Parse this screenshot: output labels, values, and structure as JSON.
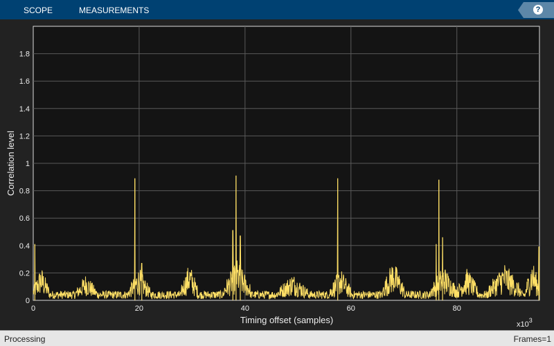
{
  "toolbar": {
    "tabs": [
      "SCOPE",
      "MEASUREMENTS"
    ],
    "help_label": "?"
  },
  "status": {
    "left": "Processing",
    "right": "Frames=1"
  },
  "colors": {
    "line": "#ffe066",
    "axes_bg": "#141414",
    "grid": "#5a5a5a"
  },
  "chart_data": {
    "type": "line",
    "xlabel": "Timing offset (samples)",
    "ylabel": "Correlation level",
    "x_multiplier": "x10",
    "x_multiplier_exp": "3",
    "xlim": [
      0,
      95.6
    ],
    "ylim": [
      0,
      2
    ],
    "xticks": [
      0,
      20,
      40,
      60,
      80
    ],
    "yticks": [
      0,
      0.2,
      0.4,
      0.6,
      0.8,
      1,
      1.2,
      1.4,
      1.6,
      1.8
    ],
    "ytick_labels": [
      "0",
      "0.2",
      "0.4",
      "0.6",
      "0.8",
      "1",
      "1.2",
      "1.4",
      "1.6",
      "1.8"
    ],
    "grid": true,
    "baseline": 0.07,
    "clusters": [
      [
        0,
        3,
        0.25
      ],
      [
        8,
        12,
        0.2
      ],
      [
        18,
        22,
        0.24
      ],
      [
        28,
        31,
        0.28
      ],
      [
        36,
        41,
        0.3
      ],
      [
        46,
        52,
        0.2
      ],
      [
        56,
        60,
        0.24
      ],
      [
        66,
        70,
        0.3
      ],
      [
        75,
        80,
        0.26
      ],
      [
        80,
        84,
        0.24
      ],
      [
        86,
        92,
        0.28
      ],
      [
        93,
        95.6,
        0.3
      ]
    ],
    "peaks": [
      [
        0.3,
        0.41
      ],
      [
        19.2,
        0.89
      ],
      [
        20.5,
        0.27
      ],
      [
        37.7,
        0.51
      ],
      [
        38.3,
        0.91
      ],
      [
        39.1,
        0.47
      ],
      [
        57.5,
        0.89
      ],
      [
        76.1,
        0.41
      ],
      [
        76.6,
        0.88
      ],
      [
        77.3,
        0.46
      ],
      [
        95.5,
        0.39
      ]
    ]
  }
}
